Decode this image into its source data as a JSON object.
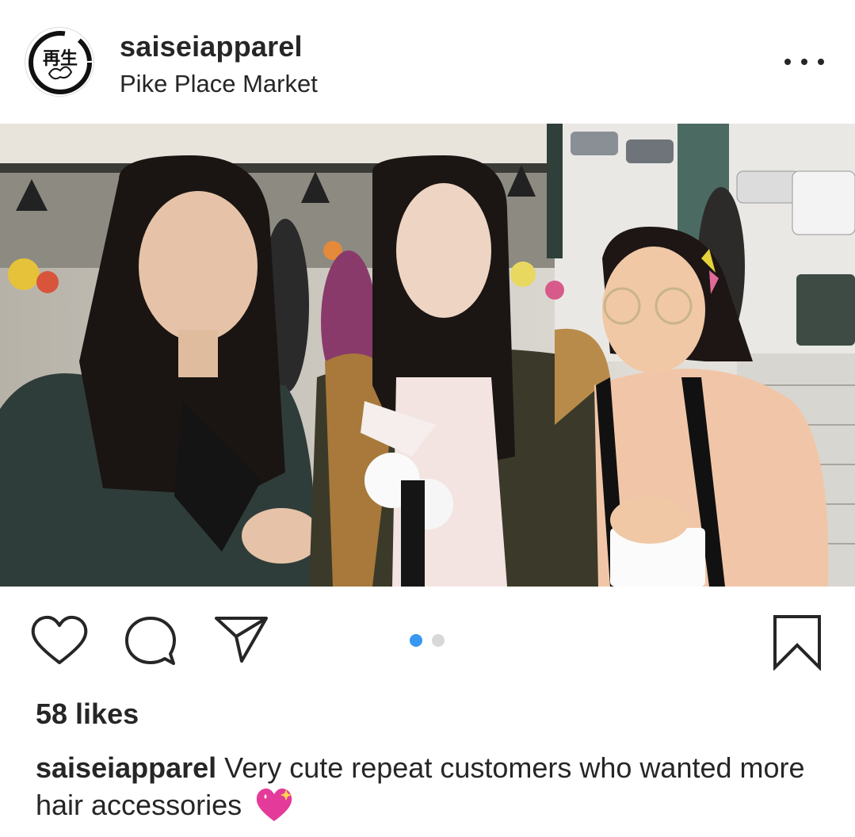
{
  "post": {
    "username": "saiseiapparel",
    "location": "Pike Place Market",
    "avatar_text": "再生",
    "likes_text": "58 likes",
    "caption_username": "saiseiapparel",
    "caption_text": "Very cute repeat customers who wanted more hair accessories",
    "caption_emoji": "sparkling-heart-icon"
  },
  "carousel": {
    "total": 2,
    "active_index": 0,
    "active_color": "#3897f0",
    "inactive_color": "#d8d8d8"
  },
  "icons": {
    "like": "heart-outline-icon",
    "comment": "comment-bubble-icon",
    "share": "paper-plane-icon",
    "save": "bookmark-icon",
    "more": "more-dots-icon"
  }
}
